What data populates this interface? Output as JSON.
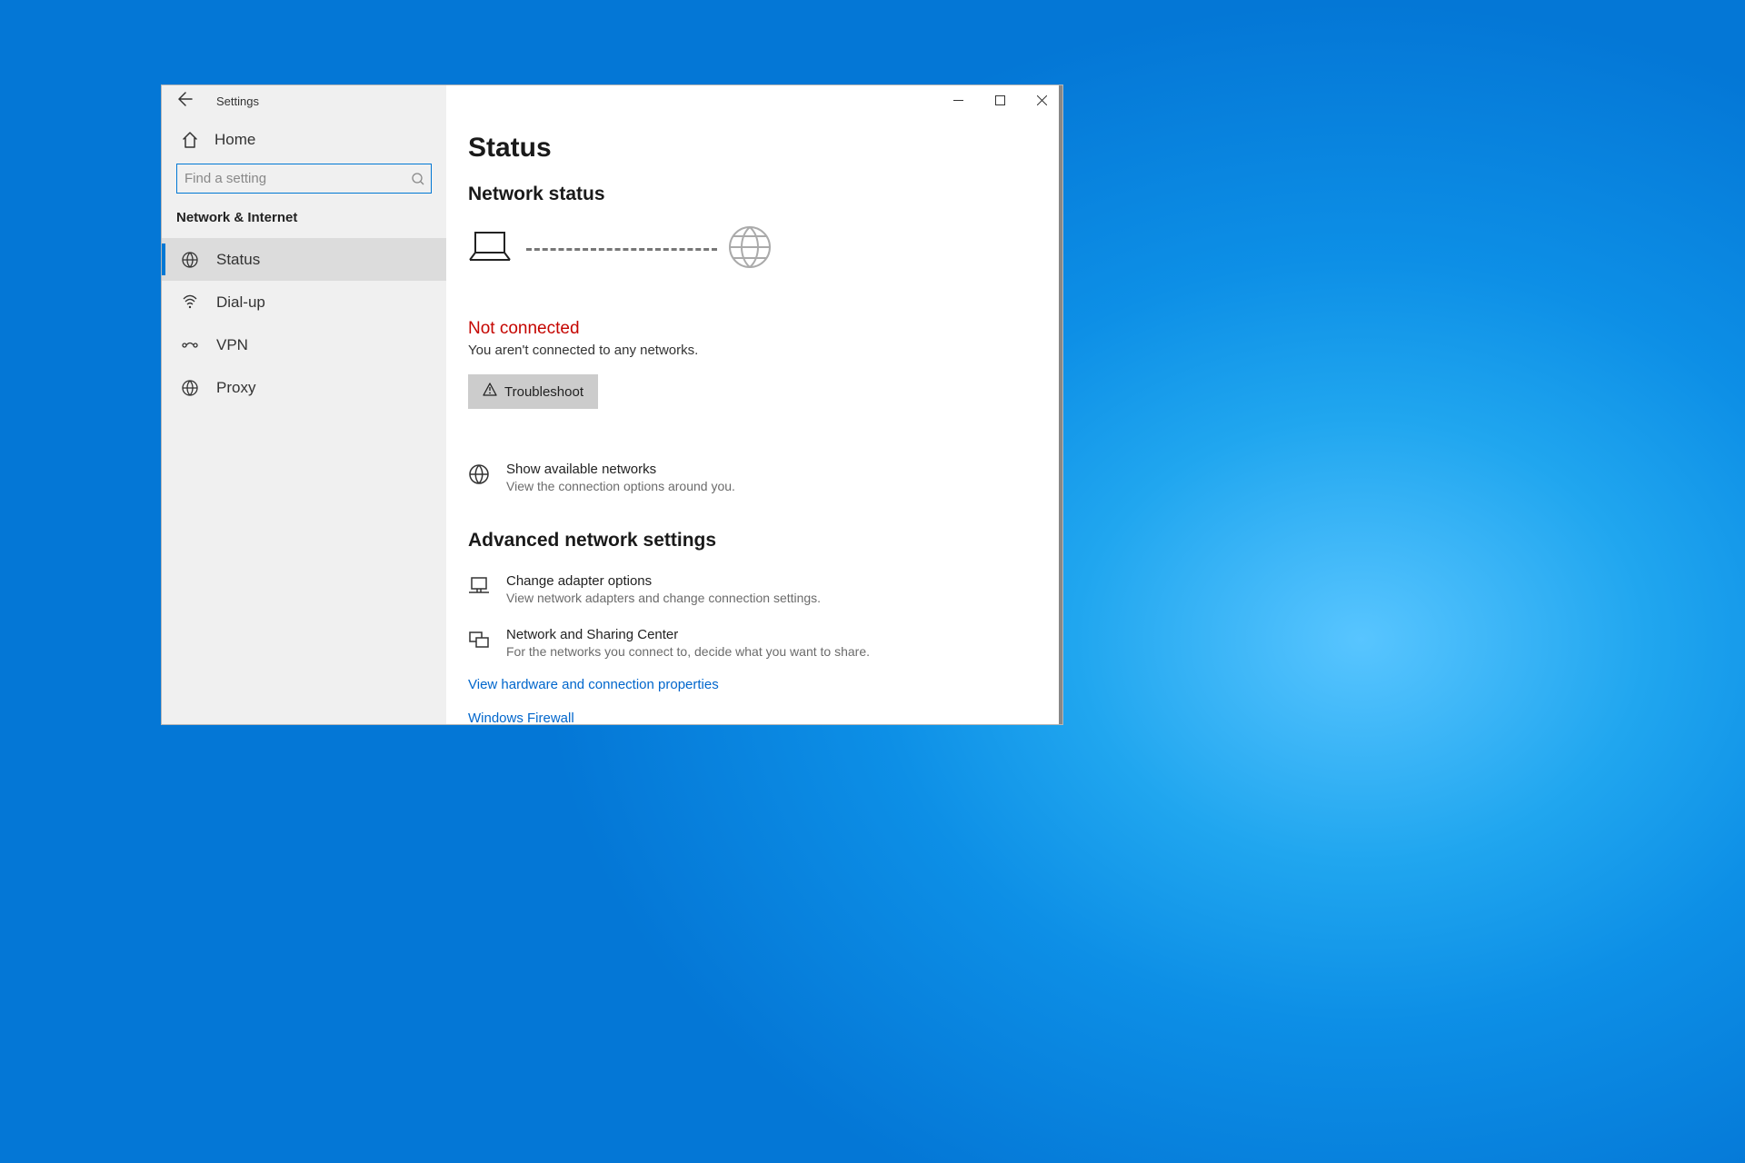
{
  "app_title": "Settings",
  "sidebar": {
    "home": "Home",
    "search_placeholder": "Find a setting",
    "category": "Network & Internet",
    "items": [
      {
        "label": "Status"
      },
      {
        "label": "Dial-up"
      },
      {
        "label": "VPN"
      },
      {
        "label": "Proxy"
      }
    ]
  },
  "main": {
    "page_title": "Status",
    "network_status_h": "Network status",
    "not_connected": "Not connected",
    "not_connected_sub": "You aren't connected to any networks.",
    "troubleshoot_label": "Troubleshoot",
    "show_networks_title": "Show available networks",
    "show_networks_sub": "View the connection options around you.",
    "advanced_h": "Advanced network settings",
    "adapter_title": "Change adapter options",
    "adapter_sub": "View network adapters and change connection settings.",
    "sharing_title": "Network and Sharing Center",
    "sharing_sub": "For the networks you connect to, decide what you want to share.",
    "link_hw": "View hardware and connection properties",
    "link_fw": "Windows Firewall"
  }
}
